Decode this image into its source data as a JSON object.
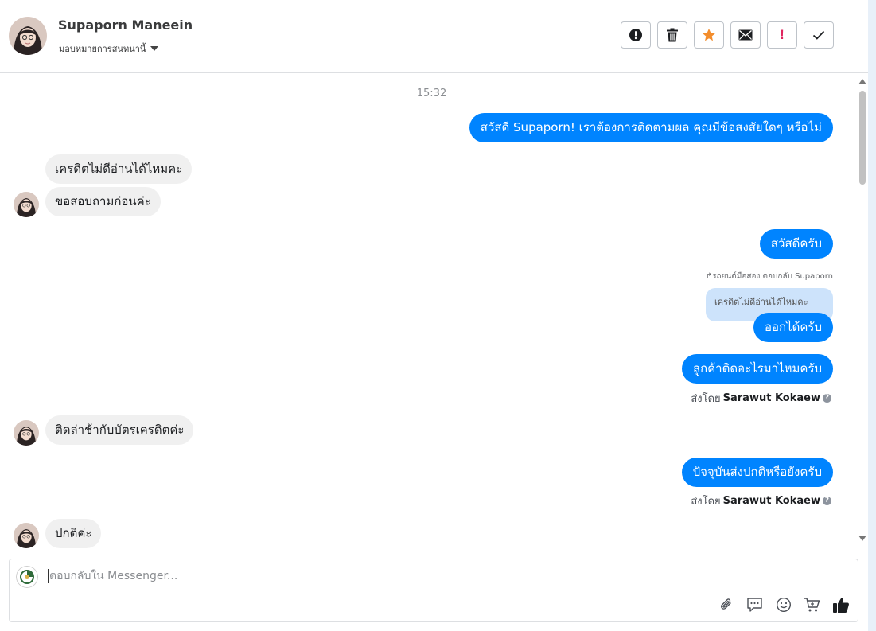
{
  "header": {
    "contact_name": "Supaporn Maneein",
    "assign_label": "มอบหมายการสนทนานี้",
    "toolbar": [
      {
        "name": "report-button",
        "icon": "exclamation-circle-icon"
      },
      {
        "name": "delete-button",
        "icon": "trash-icon"
      },
      {
        "name": "star-button",
        "icon": "star-icon",
        "color": "#f38d2c"
      },
      {
        "name": "mail-button",
        "icon": "envelope-icon"
      },
      {
        "name": "mark-important-button",
        "icon": "exclamation-icon",
        "color": "#e0245e",
        "glyph": "!"
      },
      {
        "name": "done-button",
        "icon": "check-icon"
      }
    ]
  },
  "thread": {
    "timestamp": "15:32",
    "messages": [
      {
        "dir": "out",
        "text": "สวัสดี Supaporn! เราต้องการติดตามผล คุณมีข้อสงสัยใดๆ หรือไม่"
      },
      {
        "dir": "in",
        "text": "เครดิตไม่ดีอ่านได้ไหมคะ"
      },
      {
        "dir": "in",
        "text": "ขอสอบถามก่อนค่ะ"
      },
      {
        "dir": "out",
        "text": "สวัสดีครับ"
      },
      {
        "dir": "out",
        "text": "ออกได้ครับ",
        "reply_label": "รถยนต์มือสอง ตอบกลับ Supaporn",
        "quoted": "เครดิตไม่ดีอ่านได้ไหมคะ"
      },
      {
        "dir": "out",
        "text": "ลูกค้าติดอะไรมาไหมครับ",
        "sent_by_prefix": "ส่งโดย",
        "sent_by": "Sarawut Kokaew"
      },
      {
        "dir": "in",
        "text": "ติดล่าช้ากับบัตรเครดิตค่ะ"
      },
      {
        "dir": "out",
        "text": "ปัจจุบันส่งปกติหรือยังครับ",
        "sent_by_prefix": "ส่งโดย",
        "sent_by": "Sarawut Kokaew"
      },
      {
        "dir": "in",
        "text": "ปกติค่ะ"
      }
    ]
  },
  "composer": {
    "placeholder": "ตอบกลับใน Messenger...",
    "value": "",
    "tools": [
      "paperclip-icon",
      "speech-bubble-icon",
      "emoji-icon",
      "cart-icon",
      "thumbs-up-icon"
    ]
  },
  "colors": {
    "outgoing_bubble": "#0084ff",
    "incoming_bubble": "#f0f0f0",
    "quoted_bubble": "#cde3fb"
  }
}
